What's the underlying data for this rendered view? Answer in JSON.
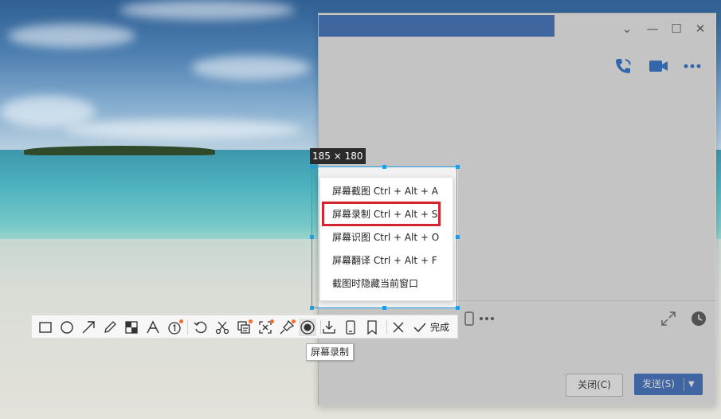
{
  "selection": {
    "size_label": "185 × 180"
  },
  "menu": {
    "items": [
      {
        "label": "屏幕截图 Ctrl + Alt + A"
      },
      {
        "label": "屏幕录制 Ctrl + Alt + S",
        "highlighted": true
      },
      {
        "label": "屏幕识图 Ctrl + Alt + O"
      },
      {
        "label": "屏幕翻译 Ctrl + Alt + F"
      },
      {
        "label": "截图时隐藏当前窗口"
      }
    ]
  },
  "toolbar": {
    "tools": [
      "rectangle-icon",
      "ellipse-icon",
      "arrow-icon",
      "pencil-icon",
      "mosaic-icon",
      "text-icon",
      "number-marker-icon",
      "undo-icon",
      "scissors-icon",
      "copy-text-icon",
      "scan-icon",
      "pin-icon",
      "record-icon",
      "download-icon",
      "phone-icon",
      "bookmark-icon",
      "close-icon",
      "check-icon"
    ],
    "done_label": "完成",
    "active_tool_tooltip": "屏幕录制"
  },
  "chat": {
    "close_button": "关闭(C)",
    "send_button": "发送(S)"
  },
  "colors": {
    "selection_border": "#1e9fe6",
    "highlight_border": "#d1262f",
    "send_button": "#3a6fc4",
    "badge_dot": "#ff6a2b"
  }
}
